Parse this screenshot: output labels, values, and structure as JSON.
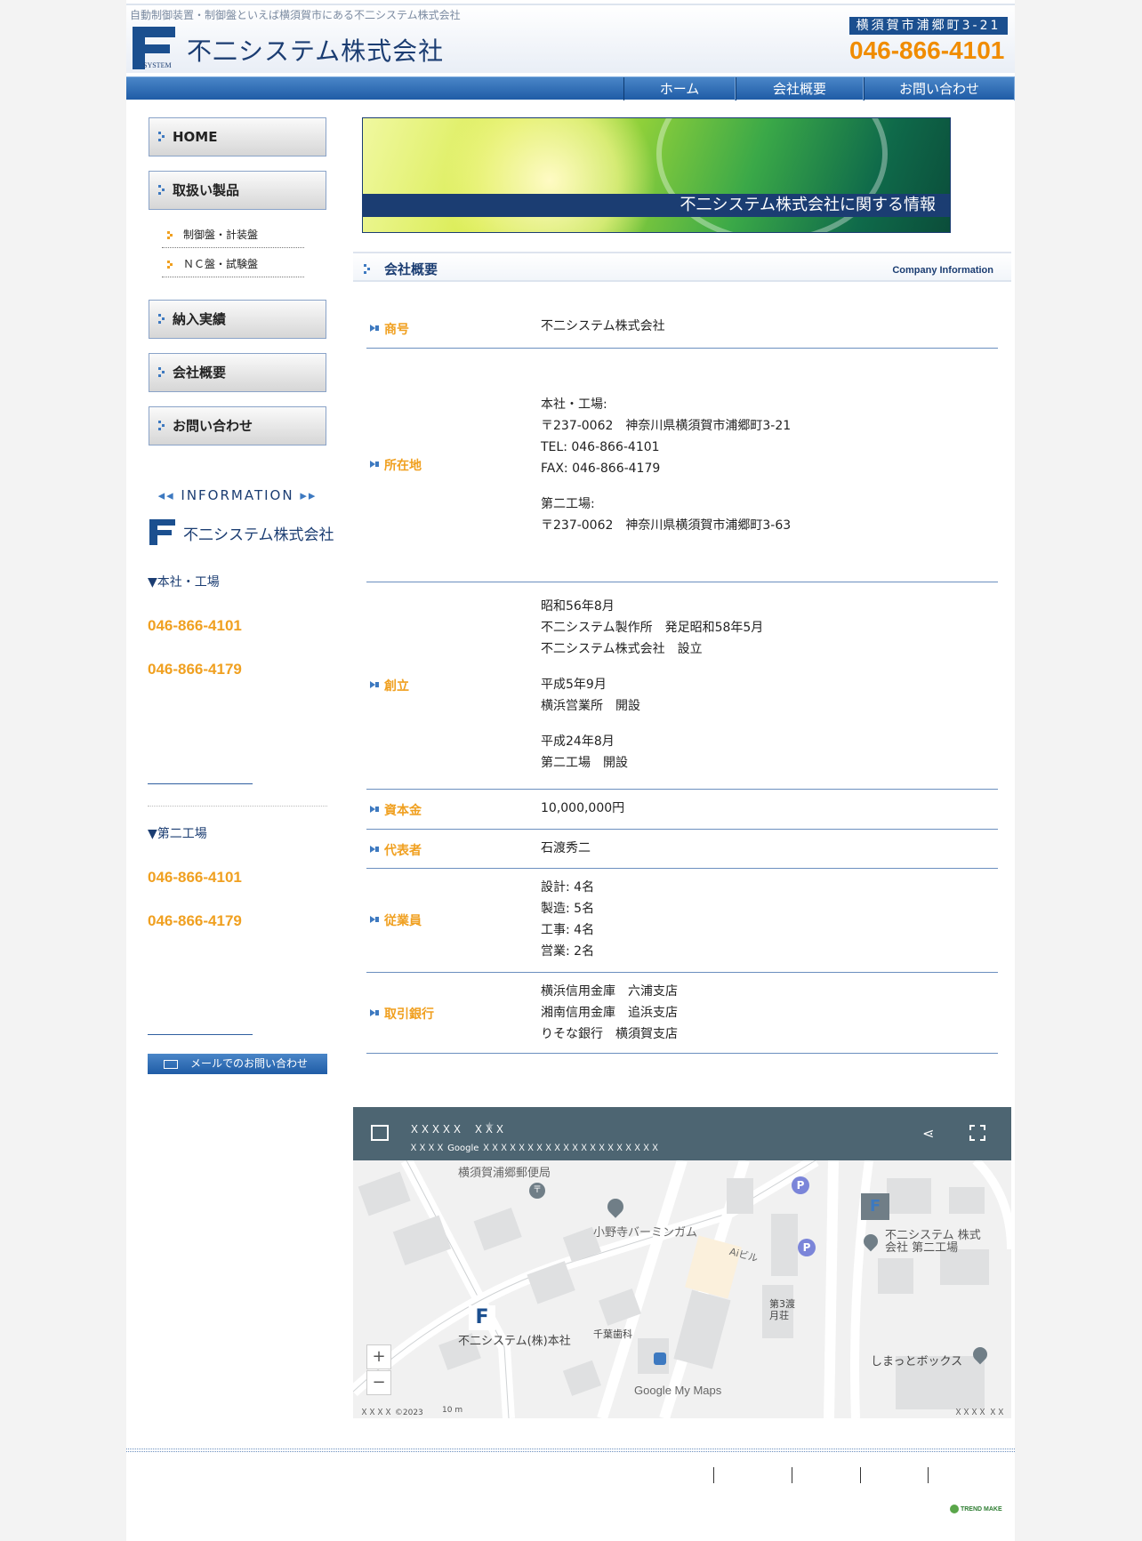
{
  "header": {
    "tagline": "自動制御装置・制御盤といえば横須賀市にある不二システム株式会社",
    "company_name": "不二システム株式会社",
    "logo_subtext": "SYSTEM",
    "address_badge": "横須賀市浦郷町3-21",
    "phone": "046-866-4101"
  },
  "nav": {
    "items": [
      "ホーム",
      "会社概要",
      "お問い合わせ"
    ]
  },
  "sidebar": {
    "buttons": [
      "HOME",
      "取扱い製品",
      "納入実績",
      "会社概要",
      "お問い合わせ"
    ],
    "sub_items": [
      "制御盤・計装盤",
      "ＮＣ盤・試験盤"
    ],
    "info_heading": "INFORMATION",
    "info_company": "不二システム株式会社",
    "office1": {
      "label": "▼本社・工場",
      "tel": "046-866-4101",
      "fax": "046-866-4179"
    },
    "office2": {
      "label": "▼第二工場",
      "tel": "046-866-4101",
      "fax": "046-866-4179"
    },
    "mail_button": "メールでのお問い合わせ"
  },
  "banner": {
    "caption": "不二システム株式会社に関する情報"
  },
  "section": {
    "title": "会社概要",
    "subtitle": "Company Information"
  },
  "company_info": [
    {
      "label": "商号",
      "lines": [
        "不二システム株式会社"
      ]
    },
    {
      "label": "所在地",
      "lines": [
        "本社・工場:",
        "〒237-0062　神奈川県横須賀市浦郷町3-21",
        "TEL: 046-866-4101",
        "FAX: 046-866-4179",
        "",
        "第二工場:",
        "〒237-0062　神奈川県横須賀市浦郷町3-63"
      ]
    },
    {
      "label": "創立",
      "lines": [
        "昭和56年8月",
        " 不二システム製作所　発足昭和58年5月",
        " 不二システム株式会社　設立",
        "",
        "平成5年9月",
        "横浜営業所　開設",
        "",
        "平成24年8月",
        "第二工場　開設"
      ]
    },
    {
      "label": "資本金",
      "lines": [
        "10,000,000円"
      ]
    },
    {
      "label": "代表者",
      "lines": [
        "石渡秀二"
      ]
    },
    {
      "label": "従業員",
      "lines": [
        "設計: 4名",
        "製造: 5名",
        "工事: 4名",
        "営業: 2名"
      ]
    },
    {
      "label": "取引銀行",
      "lines": [
        "横浜信用金庫　六浦支店",
        "湘南信用金庫　追浜支店",
        "りそな銀行　横須賀支店"
      ]
    }
  ],
  "map": {
    "title": "ＸＸＸＸＸ　ＸＸＸ",
    "notice": "ＸＸＸＸ Google ＸＸＸＸＸＸＸＸＸＸＸＸＸＸＸＸＸＸＸＸ",
    "labels": {
      "post": "横須賀浦郷郵便局",
      "gum": "小野寺バーミンガム",
      "ai": "Aiビル",
      "factory2": "不二システム 株式\n会社 第二工場",
      "apt": "第3渡\n月荘",
      "hq": "不二システム(株)本社",
      "dentist": "千葉歯科",
      "box": "しまっとボックス",
      "brand": "Google My Maps"
    },
    "footer_left": "ＸＸＸＸ ©2023",
    "footer_scale": "10 m",
    "footer_right": "ＸＸＸＸ ＸＸＸＸＸ"
  },
  "footer": {
    "badge": "TREND MAKE"
  }
}
